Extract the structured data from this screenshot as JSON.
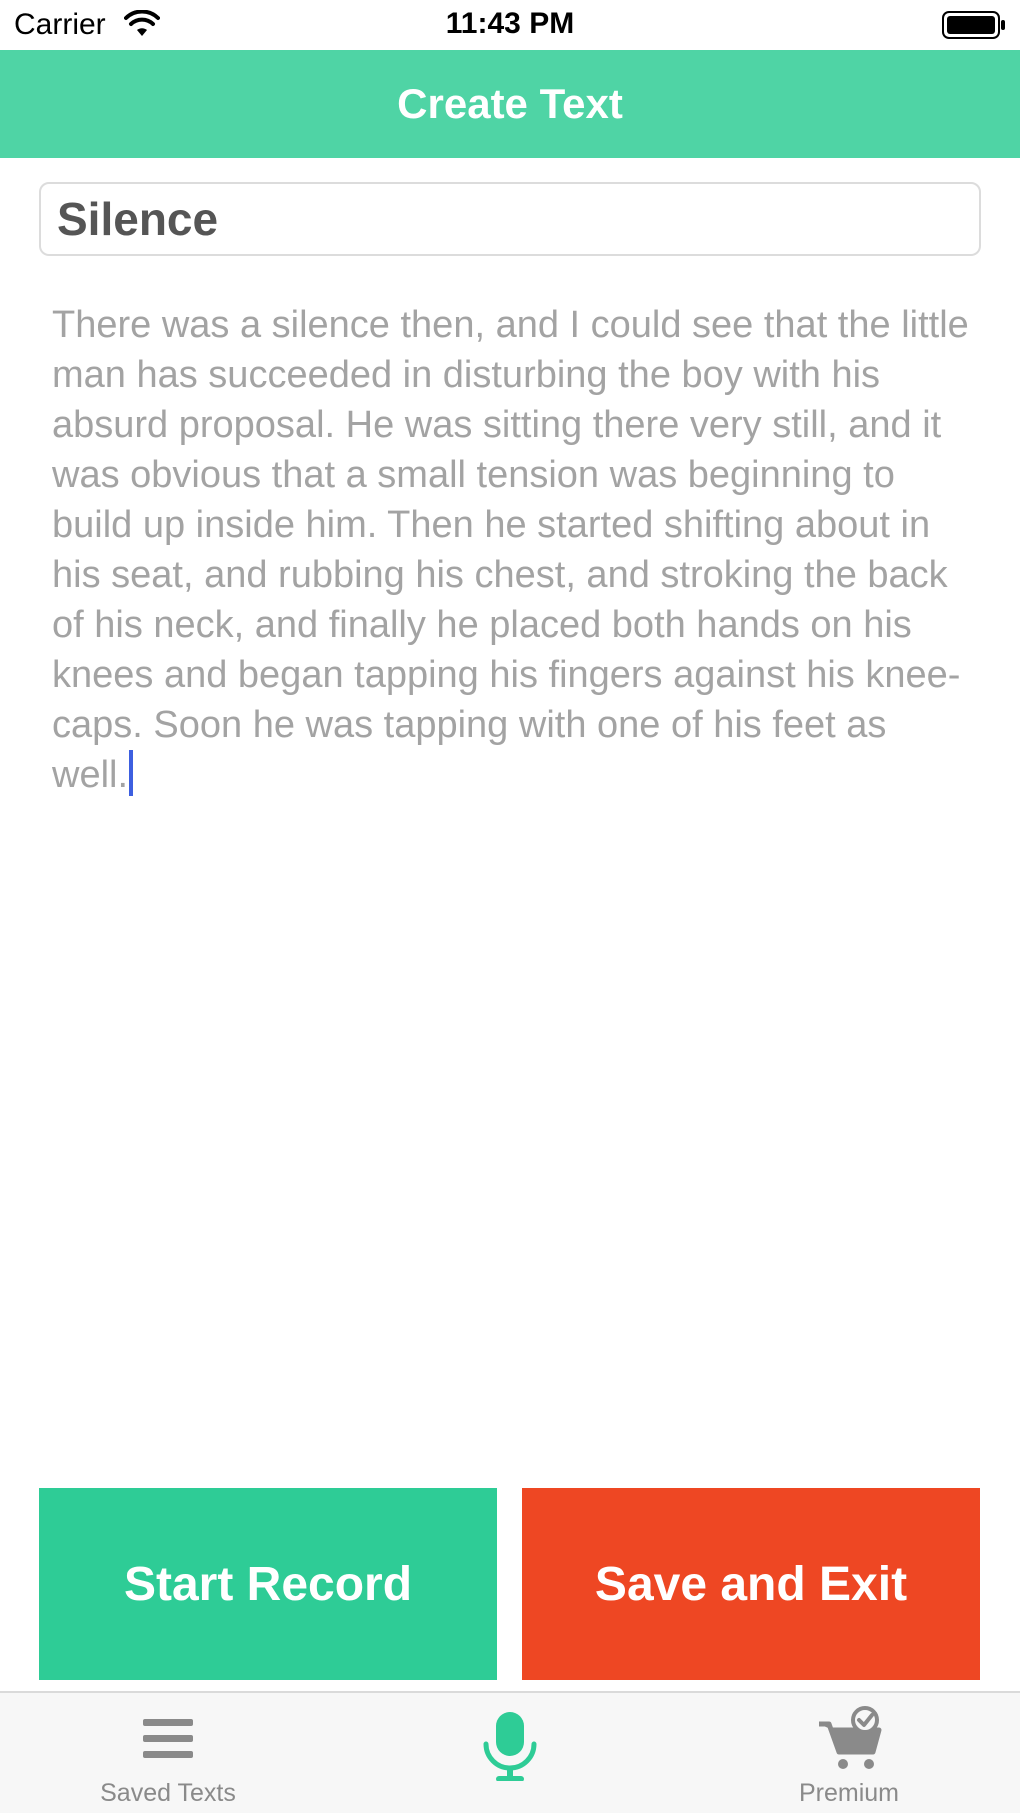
{
  "status_bar": {
    "carrier": "Carrier",
    "time": "11:43 PM",
    "wifi_icon": "wifi-icon",
    "battery_icon": "battery-full-icon"
  },
  "nav": {
    "title": "Create Text",
    "color": "#4fd4a5"
  },
  "editor": {
    "title_value": "Silence",
    "body_text": "There was a silence then, and I could see that the little man has succeeded in disturbing the boy with his absurd proposal. He was sitting there very still, and it was obvious that a small tension was beginning to build up inside him. Then he started shifting about in his seat, and rubbing his chest, and stroking the back of his neck, and finally he placed both hands on his knees and began tapping his fingers against his knee-caps. Soon he was tapping with one of his feet as well."
  },
  "buttons": {
    "start_record": {
      "label": "Start Record",
      "color": "#2ecc96"
    },
    "save_exit": {
      "label": "Save and Exit",
      "color": "#ee4723"
    }
  },
  "tabs": [
    {
      "label": "Saved Texts",
      "icon": "list-icon"
    },
    {
      "label": "",
      "icon": "microphone-icon",
      "color": "#2ecc96"
    },
    {
      "label": "Premium",
      "icon": "cart-icon"
    }
  ]
}
